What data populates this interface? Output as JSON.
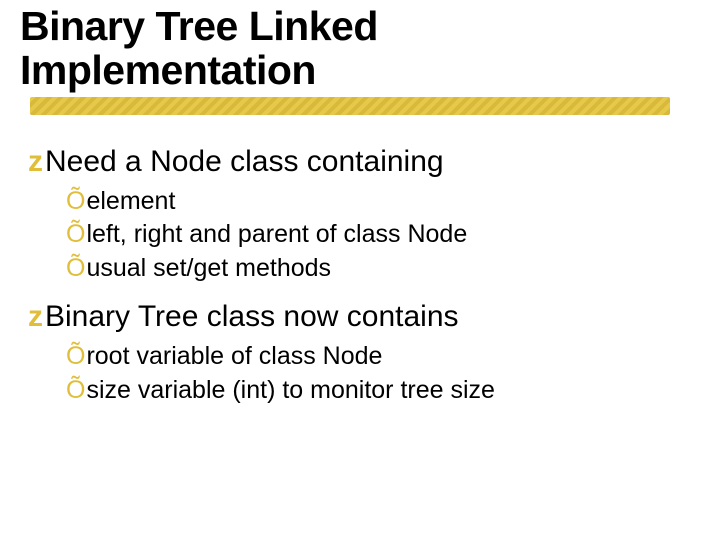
{
  "title_line1": "Binary Tree Linked",
  "title_line2": "Implementation",
  "bullets": {
    "b1": {
      "glyph": "z",
      "text": "Need a Node class containing"
    },
    "b1_subs": {
      "s1": {
        "glyph": "Õ",
        "text": "element"
      },
      "s2": {
        "glyph": "Õ",
        "text": "left, right and parent of class Node"
      },
      "s3": {
        "glyph": "Õ",
        "text": "usual set/get methods"
      }
    },
    "b2": {
      "glyph": "z",
      "text": "Binary Tree class now contains"
    },
    "b2_subs": {
      "s1": {
        "glyph": "Õ",
        "text": "root variable of class Node"
      },
      "s2": {
        "glyph": "Õ",
        "text": "size variable (int) to monitor tree size"
      }
    }
  }
}
